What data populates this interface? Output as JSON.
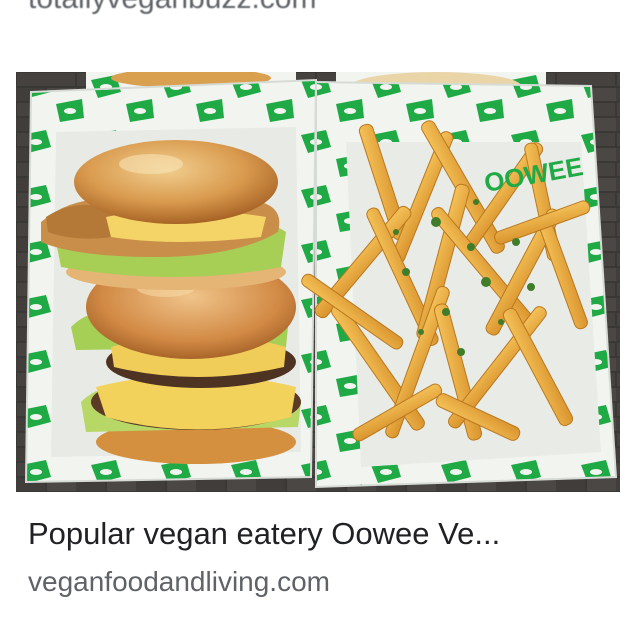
{
  "previous_result": {
    "source": "totallyveganbuzz.com"
  },
  "result": {
    "title": "Popular vegan eatery Oowee Ve...",
    "source": "veganfoodandliving.com",
    "image_alt": "Vegan burgers and fries in paper-lined baskets",
    "wrapper_logo_text": "OOWEE"
  },
  "colors": {
    "title_text": "#202124",
    "source_text": "#5f6368",
    "wrapper_green": "#1faa46"
  }
}
